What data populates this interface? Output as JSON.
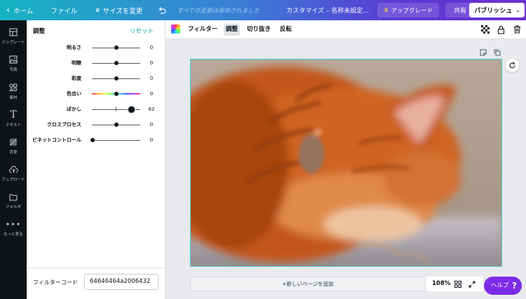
{
  "topbar": {
    "home": "ホーム",
    "file": "ファイル",
    "resize": "サイズを変更",
    "saved_status": "すべての変更は保存されました",
    "doc_title": "カスタマイズ – 名称未設定...",
    "upgrade": "アップグレード",
    "share": "共有",
    "publish": "パブリッシュ"
  },
  "nav": {
    "items": [
      {
        "label": "テンプレート",
        "icon": "template-icon"
      },
      {
        "label": "写真",
        "icon": "photo-icon"
      },
      {
        "label": "素材",
        "icon": "elements-icon"
      },
      {
        "label": "テキスト",
        "icon": "text-icon"
      },
      {
        "label": "背景",
        "icon": "background-icon"
      },
      {
        "label": "アップロード",
        "icon": "upload-icon"
      },
      {
        "label": "フォルダ",
        "icon": "folder-icon"
      },
      {
        "label": "もっと見る",
        "icon": "more-icon"
      }
    ]
  },
  "panel": {
    "title": "調整",
    "reset": "リセット",
    "sliders": [
      {
        "label": "明るさ",
        "value": "0"
      },
      {
        "label": "明瞭",
        "value": "0"
      },
      {
        "label": "彩度",
        "value": "0"
      },
      {
        "label": "色合い",
        "value": "0"
      },
      {
        "label": "ぼかし",
        "value": "62"
      },
      {
        "label": "クロスプロセス",
        "value": "0"
      },
      {
        "label": "ビネットコントロール",
        "value": "0"
      }
    ],
    "filter_code_label": "フィルターコード",
    "filter_code_value": "64646464a2006432"
  },
  "toolbar": {
    "filter": "フィルター",
    "adjust": "調整",
    "crop": "切り抜き",
    "flip": "反転"
  },
  "canvas": {
    "add_page": "+新しいページを追加",
    "zoom": "108%"
  },
  "help": {
    "label": "ヘルプ",
    "q": "?"
  },
  "colors": {
    "accent": "#00a0b4",
    "help": "#7d2ae8",
    "nav_bg": "#0e1318"
  }
}
